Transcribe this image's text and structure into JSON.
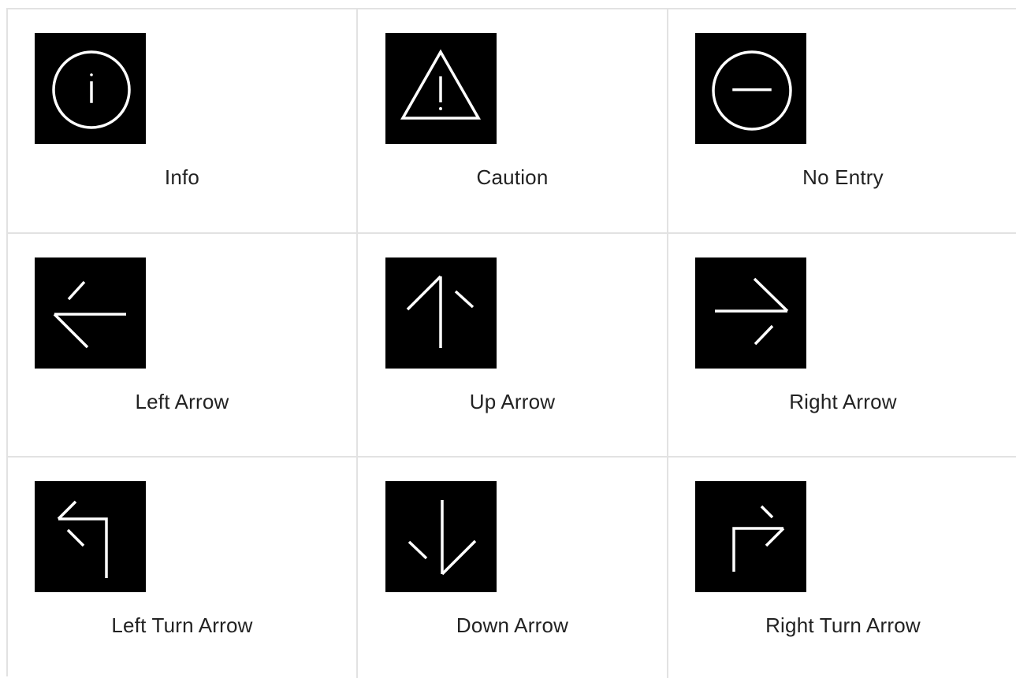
{
  "colors": {
    "tile_background": "#000000",
    "glyph_stroke": "#ffffff",
    "grid_line": "#e2e2e2",
    "label_text": "#222222"
  },
  "tiles": [
    {
      "label": "Info",
      "icon": "info-icon"
    },
    {
      "label": "Caution",
      "icon": "caution-icon"
    },
    {
      "label": "No Entry",
      "icon": "no-entry-icon"
    },
    {
      "label": "Left Arrow",
      "icon": "left-arrow-icon"
    },
    {
      "label": "Up Arrow",
      "icon": "up-arrow-icon"
    },
    {
      "label": "Right Arrow",
      "icon": "right-arrow-icon"
    },
    {
      "label": "Left Turn Arrow",
      "icon": "left-turn-arrow-icon"
    },
    {
      "label": "Down Arrow",
      "icon": "down-arrow-icon"
    },
    {
      "label": "Right Turn Arrow",
      "icon": "right-turn-arrow-icon"
    }
  ]
}
